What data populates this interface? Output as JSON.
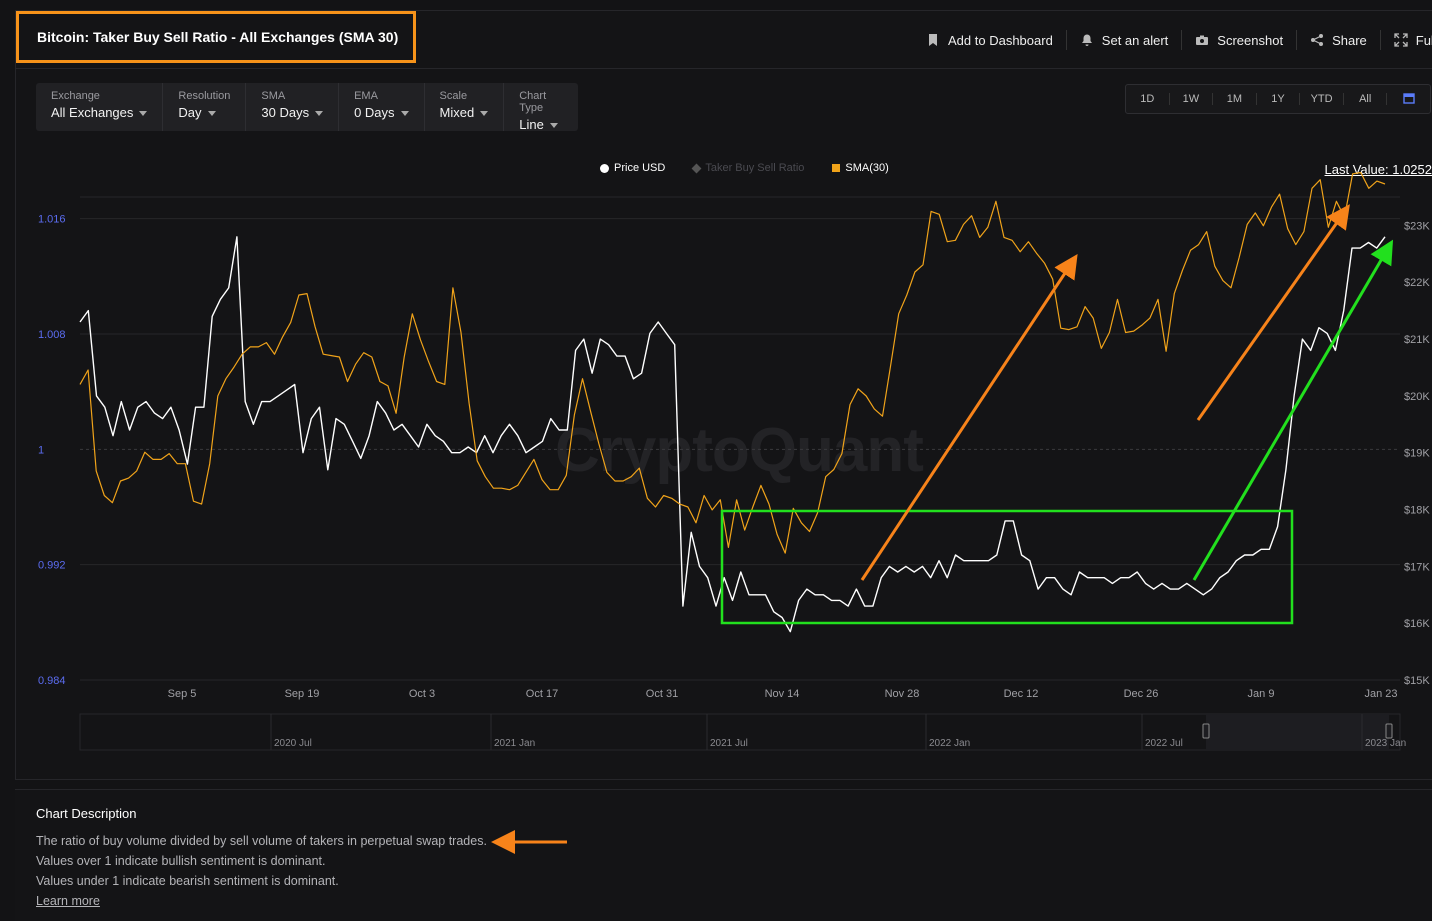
{
  "header": {
    "title": "Bitcoin: Taker Buy Sell Ratio - All Exchanges (SMA 30)",
    "actions": [
      "Add to Dashboard",
      "Set an alert",
      "Screenshot",
      "Share",
      "Full"
    ]
  },
  "filters": [
    {
      "label": "Exchange",
      "value": "All Exchanges"
    },
    {
      "label": "Resolution",
      "value": "Day"
    },
    {
      "label": "SMA",
      "value": "30 Days"
    },
    {
      "label": "EMA",
      "value": "0 Days"
    },
    {
      "label": "Scale",
      "value": "Mixed"
    },
    {
      "label": "Chart Type",
      "value": "Line"
    }
  ],
  "ranges": [
    "1D",
    "1W",
    "1M",
    "1Y",
    "YTD",
    "All"
  ],
  "legend": {
    "price": "Price USD",
    "ratio": "Taker Buy Sell Ratio",
    "sma": "SMA(30)"
  },
  "last_value": "Last Value: 1.0252",
  "watermark": "CryptoQuant",
  "description": {
    "title": "Chart Description",
    "lines": [
      "The ratio of buy volume divided by sell volume of takers in perpetual swap trades.",
      "Values over 1 indicate bullish sentiment is dominant.",
      "Values under 1 indicate bearish sentiment is dominant."
    ],
    "link": "Learn more"
  },
  "colors": {
    "price": "#ffffff",
    "sma": "#f0a31a",
    "annotation_orange": "#f7831a",
    "annotation_green": "#22e01e",
    "left_axis": "#5b6cf0"
  },
  "chart_data": {
    "type": "line",
    "x_ticks": [
      "Sep 5",
      "Sep 19",
      "Oct 3",
      "Oct 17",
      "Oct 31",
      "Nov 14",
      "Nov 28",
      "Dec 12",
      "Dec 26",
      "Jan 9",
      "Jan 23"
    ],
    "y_left_ticks": [
      "1.016",
      "1.008",
      "1",
      "0.992",
      "0.984"
    ],
    "y_left_range": [
      0.984,
      1.0175
    ],
    "y_right_ticks": [
      "$23K",
      "$22K",
      "$21K",
      "$20K",
      "$19K",
      "$18K",
      "$17K",
      "$16K",
      "$15K"
    ],
    "y_right_range": [
      15000,
      23500
    ],
    "navigator_labels": [
      "2020 Jul",
      "2021 Jan",
      "2021 Jul",
      "2022 Jan",
      "2022 Jul",
      "2023 Jan"
    ],
    "series": [
      {
        "name": "Price USD",
        "axis": "right",
        "values": [
          21300,
          21500,
          20000,
          19800,
          19300,
          19900,
          19400,
          19800,
          19900,
          19700,
          19600,
          19800,
          19400,
          18800,
          19800,
          19800,
          21400,
          21700,
          21900,
          22800,
          19900,
          19500,
          19900,
          19900,
          20000,
          20100,
          20200,
          19000,
          19600,
          19800,
          18700,
          19600,
          19500,
          19200,
          18900,
          19300,
          19900,
          19700,
          19400,
          19500,
          19300,
          19100,
          19500,
          19300,
          19200,
          19000,
          19000,
          19100,
          19000,
          19300,
          19000,
          19300,
          19500,
          19300,
          19000,
          19100,
          19200,
          19600,
          19400,
          19400,
          20800,
          21000,
          20400,
          21000,
          20900,
          20700,
          20700,
          20300,
          20400,
          21100,
          21300,
          21100,
          20900,
          16300,
          17600,
          17000,
          16800,
          16300,
          16800,
          16400,
          16900,
          16500,
          16500,
          16500,
          16200,
          16100,
          15850,
          16400,
          16600,
          16500,
          16500,
          16400,
          16400,
          16300,
          16600,
          16300,
          16300,
          16800,
          17000,
          16900,
          17000,
          16900,
          17000,
          16800,
          17100,
          16800,
          17200,
          17100,
          17100,
          17100,
          17100,
          17200,
          17800,
          17800,
          17200,
          17100,
          16600,
          16800,
          16800,
          16600,
          16500,
          16900,
          16800,
          16800,
          16800,
          16700,
          16800,
          16800,
          16900,
          16700,
          16600,
          16700,
          16600,
          16600,
          16700,
          16600,
          16500,
          16600,
          16800,
          16900,
          17100,
          17200,
          17200,
          17300,
          17300,
          17700,
          18700,
          20000,
          21000,
          20800,
          21200,
          21100,
          20800,
          21500,
          22600,
          22600,
          22700,
          22600,
          22800
        ]
      },
      {
        "name": "SMA(30)",
        "axis": "left",
        "values": [
          1.0045,
          1.0055,
          0.9985,
          0.9968,
          0.9963,
          0.9978,
          0.998,
          0.9985,
          0.9998,
          0.9993,
          0.9993,
          0.9997,
          0.999,
          0.999,
          0.9964,
          0.9962,
          0.999,
          1.0037,
          1.0049,
          1.0057,
          1.0066,
          1.0071,
          1.0071,
          1.0074,
          1.0066,
          1.0078,
          1.0088,
          1.0107,
          1.0108,
          1.0085,
          1.0066,
          1.0065,
          1.0064,
          1.0047,
          1.0059,
          1.0067,
          1.0064,
          1.0047,
          1.0044,
          1.0025,
          1.0064,
          1.0094,
          1.0076,
          1.0061,
          1.0047,
          1.0045,
          1.0112,
          1.0081,
          1.0032,
          0.9992,
          0.9981,
          0.9973,
          0.9973,
          0.9972,
          0.9975,
          0.9984,
          0.9993,
          0.9979,
          0.9972,
          0.9972,
          0.9982,
          1.0024,
          1.0049,
          1.0026,
          1.0004,
          0.9984,
          0.9978,
          0.9978,
          0.9981,
          0.9987,
          0.9966,
          0.996,
          0.9968,
          0.9966,
          0.9962,
          0.996,
          0.9949,
          0.9968,
          0.9958,
          0.9965,
          0.9932,
          0.9965,
          0.9944,
          0.996,
          0.9975,
          0.9962,
          0.9941,
          0.9928,
          0.9959,
          0.9949,
          0.9943,
          0.9956,
          0.9981,
          0.9986,
          0.9997,
          1.0031,
          1.0042,
          1.0037,
          1.0028,
          1.0023,
          1.0058,
          1.0094,
          1.0107,
          1.0123,
          1.0128,
          1.0165,
          1.0163,
          1.0144,
          1.0145,
          1.0156,
          1.0162,
          1.0147,
          1.0154,
          1.0172,
          1.0147,
          1.0145,
          1.0137,
          1.0144,
          1.0136,
          1.0129,
          1.0118,
          1.0084,
          1.0083,
          1.0085,
          1.0099,
          1.0091,
          1.007,
          1.0081,
          1.0104,
          1.0081,
          1.0082,
          1.0086,
          1.0091,
          1.0104,
          1.0068,
          1.0108,
          1.0124,
          1.0138,
          1.0142,
          1.0151,
          1.0127,
          1.0117,
          1.0112,
          1.0133,
          1.0156,
          1.0164,
          1.0155,
          1.0168,
          1.0177,
          1.0153,
          1.0142,
          1.0151,
          1.0181,
          1.0187,
          1.0154,
          1.0172,
          1.0161,
          1.0191,
          1.0192,
          1.0181,
          1.0186,
          1.0184
        ]
      }
    ]
  }
}
